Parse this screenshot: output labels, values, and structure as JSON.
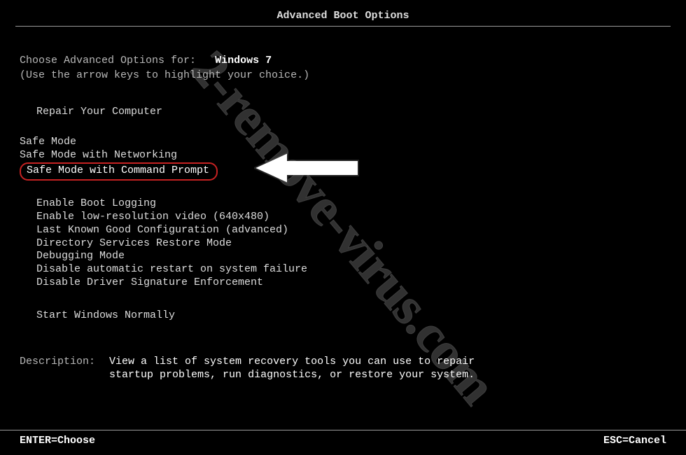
{
  "title": "Advanced Boot Options",
  "prompt": "Choose Advanced Options for:",
  "os": "Windows 7",
  "hint": "(Use the arrow keys to highlight your choice.)",
  "group1": [
    "Repair Your Computer"
  ],
  "group2": [
    "Safe Mode",
    "Safe Mode with Networking",
    "Safe Mode with Command Prompt"
  ],
  "group3": [
    "Enable Boot Logging",
    "Enable low-resolution video (640x480)",
    "Last Known Good Configuration (advanced)",
    "Directory Services Restore Mode",
    "Debugging Mode",
    "Disable automatic restart on system failure",
    "Disable Driver Signature Enforcement"
  ],
  "group4": [
    "Start Windows Normally"
  ],
  "highlighted_item": "Safe Mode with Command Prompt",
  "description_label": "Description:",
  "description_text": "View a list of system recovery tools you can use to repair startup problems, run diagnostics, or restore your system.",
  "footer": {
    "enter": "ENTER=Choose",
    "esc": "ESC=Cancel"
  },
  "watermark": "2-remove-virus.com",
  "colors": {
    "highlight_border": "#c62222",
    "text": "#b8b8b8",
    "bright": "#ffffff",
    "bg": "#000000"
  }
}
